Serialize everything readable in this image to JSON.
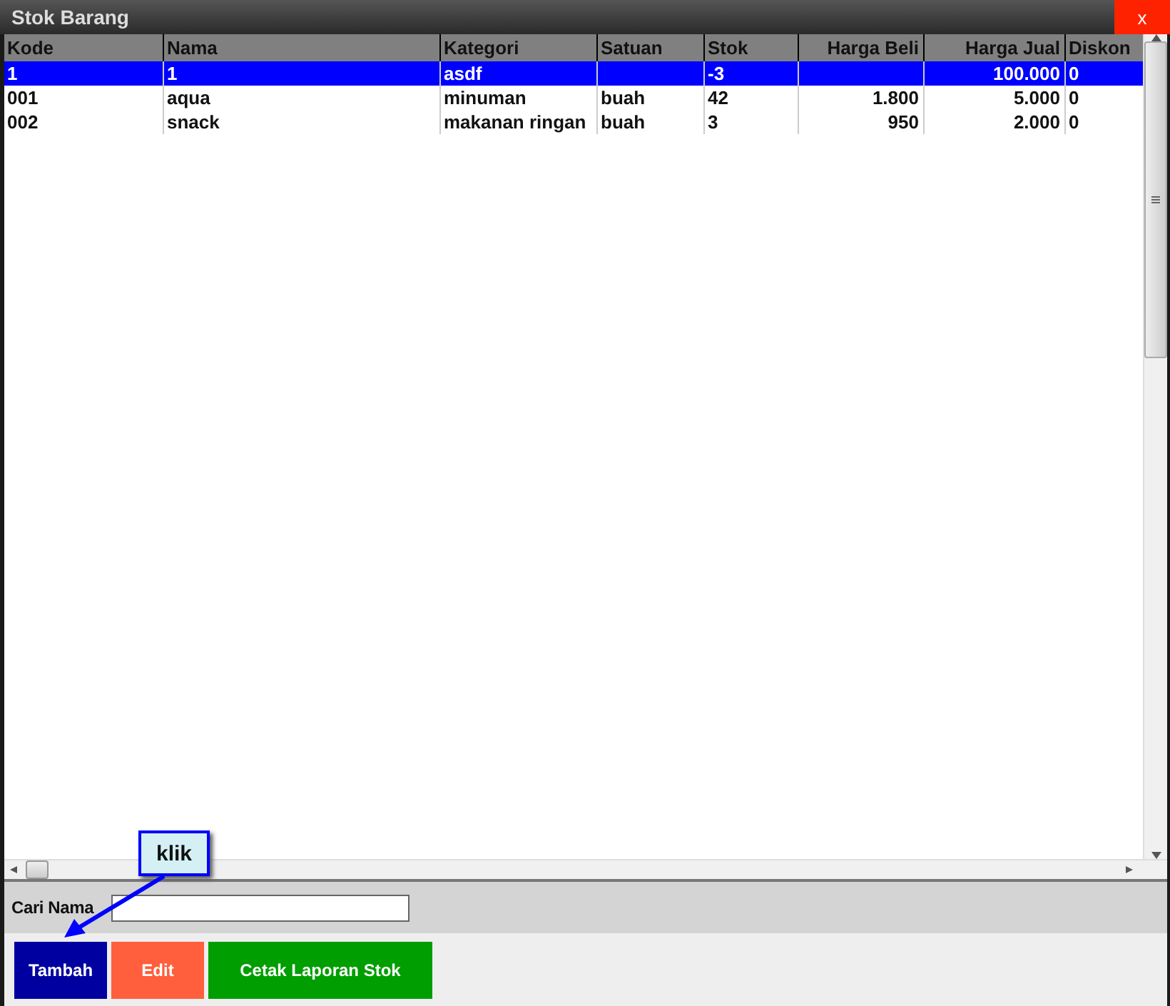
{
  "window": {
    "title": "Stok Barang",
    "close": "x"
  },
  "table": {
    "columns": [
      {
        "label": "Kode",
        "kind": "text"
      },
      {
        "label": "Nama",
        "kind": "text"
      },
      {
        "label": "Kategori",
        "kind": "text"
      },
      {
        "label": "Satuan",
        "kind": "text"
      },
      {
        "label": "Stok",
        "kind": "text"
      },
      {
        "label": "Harga Beli",
        "kind": "number"
      },
      {
        "label": "Harga Jual",
        "kind": "number"
      },
      {
        "label": "Diskon",
        "kind": "text"
      }
    ],
    "rows": [
      {
        "selected": true,
        "cells": [
          "1",
          "1",
          "asdf",
          "",
          "-3",
          "",
          "100.000",
          "0"
        ]
      },
      {
        "selected": false,
        "cells": [
          "001",
          "aqua",
          "minuman",
          "buah",
          "42",
          "1.800",
          "5.000",
          "0"
        ]
      },
      {
        "selected": false,
        "cells": [
          "002",
          "snack",
          "makanan ringan",
          "buah",
          "3",
          "950",
          "2.000",
          "0"
        ]
      }
    ]
  },
  "search": {
    "label": "Cari Nama"
  },
  "buttons": [
    {
      "label": "Tambah",
      "color": "#0000a0"
    },
    {
      "label": "Edit",
      "color": "#ff5f3c"
    },
    {
      "label": "Cetak Laporan Stok",
      "color": "#009e00"
    }
  ],
  "callout": {
    "text": "klik"
  }
}
